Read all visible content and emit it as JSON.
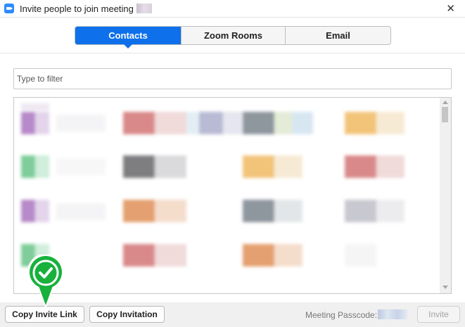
{
  "window": {
    "title": "Invite people to join meeting",
    "close_glyph": "✕"
  },
  "tabs": [
    {
      "label": "Contacts",
      "active": true
    },
    {
      "label": "Zoom Rooms",
      "active": false
    },
    {
      "label": "Email",
      "active": false
    }
  ],
  "filter": {
    "placeholder": "Type to filter",
    "value": ""
  },
  "footer": {
    "copy_invite_link_label": "Copy Invite Link",
    "copy_invitation_label": "Copy Invitation",
    "passcode_label": "Meeting Passcode:",
    "invite_label": "Invite"
  },
  "colors": {
    "accent": "#0e71eb",
    "check_green": "#17b13c"
  },
  "icons": {
    "app": "zoom-camera-icon",
    "callout": "green-check-icon"
  }
}
